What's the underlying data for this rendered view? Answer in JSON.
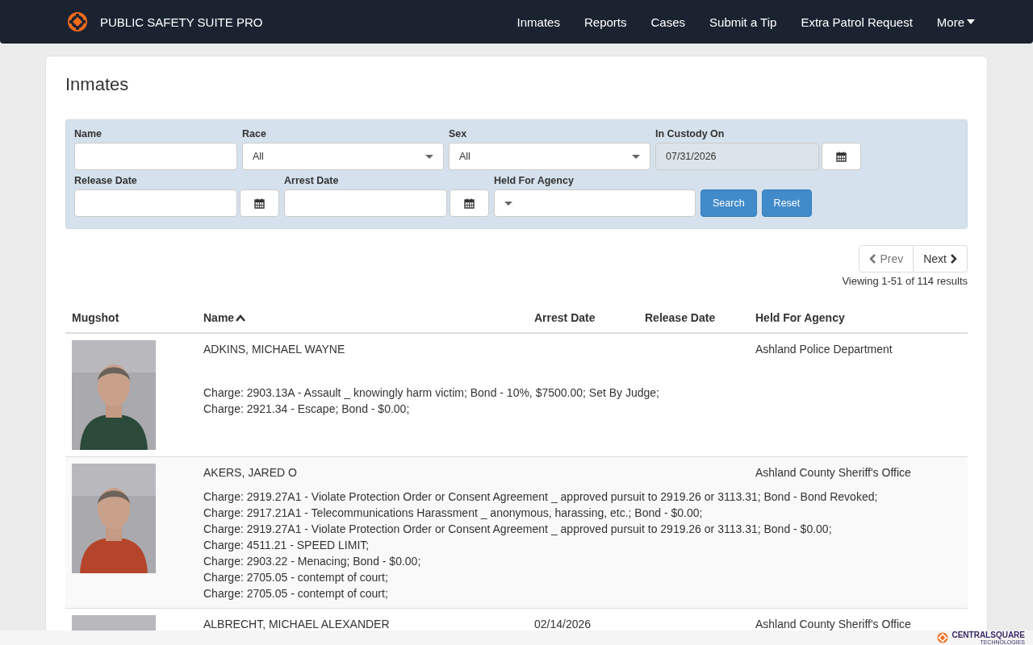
{
  "header": {
    "brand": "PUBLIC SAFETY SUITE PRO",
    "nav": [
      {
        "label": "Inmates",
        "kind": "link"
      },
      {
        "label": "Reports",
        "kind": "link"
      },
      {
        "label": "Cases",
        "kind": "link"
      },
      {
        "label": "Submit a Tip",
        "kind": "link"
      },
      {
        "label": "Extra Patrol Request",
        "kind": "link"
      },
      {
        "label": "More",
        "kind": "dropdown"
      }
    ]
  },
  "page_title": "Inmates",
  "filters": {
    "rows": [
      [
        {
          "label": "Name",
          "kind": "text"
        },
        {
          "label": "Race",
          "kind": "select",
          "value": "All"
        },
        {
          "label": "Sex",
          "kind": "select",
          "value": "All"
        },
        {
          "label": "In Custody On",
          "kind": "date",
          "value": "07/31/2026",
          "readonly": true
        }
      ],
      [
        {
          "label": "Release Date",
          "kind": "date"
        },
        {
          "label": "Arrest Date",
          "kind": "date"
        },
        {
          "label": "Held For Agency",
          "kind": "select"
        }
      ]
    ],
    "buttons": [
      "Search",
      "Reset"
    ]
  },
  "pagination": {
    "prev": {
      "label": "Prev",
      "disabled": true
    },
    "next": {
      "label": "Next",
      "disabled": false
    },
    "summary": "Viewing 1-51 of 114 results"
  },
  "table": {
    "columns": [
      {
        "label": "Mugshot"
      },
      {
        "label": "Name",
        "sorted": true
      },
      {
        "label": "Arrest Date"
      },
      {
        "label": "Release Date"
      },
      {
        "label": "Held For Agency"
      }
    ],
    "rows": [
      {
        "name": "ADKINS, MICHAEL WAYNE",
        "agency": "Ashland Police Department",
        "charges": [
          "Charge: 2903.13A - Assault _ knowingly harm victim; Bond - 10%, $7500.00; Set By Judge;",
          "Charge: 2921.34 - Escape; Bond - $0.00;"
        ]
      },
      {
        "name": "AKERS, JARED O",
        "agency": "Ashland County Sheriff's Office",
        "charges": [
          "Charge: 2919.27A1 - Violate Protection Order or Consent Agreement _ approved pursuit to 2919.26 or 3113.31; Bond - Bond Revoked;",
          "Charge: 2917.21A1 - Telecommunications Harassment _ anonymous, harassing, etc.; Bond - $0.00;",
          "Charge: 2919.27A1 - Violate Protection Order or Consent Agreement _ approved pursuit to 2919.26 or 3113.31; Bond - $0.00;",
          "Charge: 4511.21 - SPEED LIMIT;",
          "Charge: 2903.22 - Menacing; Bond - $0.00;",
          "Charge: 2705.05 - contempt of court;",
          "Charge: 2705.05 - contempt of court;"
        ]
      },
      {
        "name": "ALBRECHT, MICHAEL ALEXANDER",
        "arrest_date": "02/14/2026",
        "agency": "Ashland County Sheriff's Office",
        "charges": []
      }
    ]
  },
  "footer": {
    "logo": "CENTRALSQUARE",
    "sub": "TECHNOLOGIES"
  }
}
